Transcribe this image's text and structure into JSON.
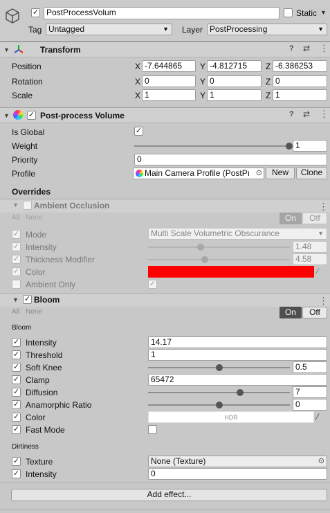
{
  "header": {
    "object_name": "PostProcessVolum",
    "static_label": "Static",
    "tag_label": "Tag",
    "tag_value": "Untagged",
    "layer_label": "Layer",
    "layer_value": "PostProcessing"
  },
  "transform": {
    "title": "Transform",
    "position_label": "Position",
    "rotation_label": "Rotation",
    "scale_label": "Scale",
    "axis_x": "X",
    "axis_y": "Y",
    "axis_z": "Z",
    "position": {
      "x": "-7.644865",
      "y": "-4.812715",
      "z": "-6.386253"
    },
    "rotation": {
      "x": "0",
      "y": "0",
      "z": "0"
    },
    "scale": {
      "x": "1",
      "y": "1",
      "z": "1"
    }
  },
  "volume": {
    "title": "Post-process Volume",
    "is_global_label": "Is Global",
    "weight_label": "Weight",
    "weight_value": "1",
    "weight_fraction": 1.0,
    "priority_label": "Priority",
    "priority_value": "0",
    "profile_label": "Profile",
    "profile_value": "Main Camera Profile (PostPı",
    "new_label": "New",
    "clone_label": "Clone",
    "overrides_label": "Overrides"
  },
  "ambient_occlusion": {
    "title": "Ambient Occlusion",
    "all_label": "All",
    "none_label": "None",
    "on_label": "On",
    "off_label": "Off",
    "mode_label": "Mode",
    "mode_value": "Multi Scale Volumetric Obscurance",
    "intensity_label": "Intensity",
    "intensity_value": "1.48",
    "intensity_fraction": 0.37,
    "thickness_label": "Thickness Modifier",
    "thickness_value": "4.58",
    "thickness_fraction": 0.4,
    "color_label": "Color",
    "color_value": "#ff0000",
    "ambient_only_label": "Ambient Only"
  },
  "bloom": {
    "title": "Bloom",
    "all_label": "All",
    "none_label": "None",
    "on_label": "On",
    "off_label": "Off",
    "section_bloom": "Bloom",
    "intensity_label": "Intensity",
    "intensity_value": "14.17",
    "threshold_label": "Threshold",
    "threshold_value": "1",
    "soft_knee_label": "Soft Knee",
    "soft_knee_value": "0.5",
    "soft_knee_fraction": 0.5,
    "clamp_label": "Clamp",
    "clamp_value": "65472",
    "diffusion_label": "Diffusion",
    "diffusion_value": "7",
    "diffusion_fraction": 0.65,
    "anamorphic_label": "Anamorphic Ratio",
    "anamorphic_value": "0",
    "anamorphic_fraction": 0.5,
    "color_label": "Color",
    "color_hdr": "HDR",
    "fast_mode_label": "Fast Mode",
    "section_dirtiness": "Dirtiness",
    "texture_label": "Texture",
    "texture_value": "None (Texture)",
    "dirt_intensity_label": "Intensity",
    "dirt_intensity_value": "0"
  },
  "footer": {
    "add_effect_label": "Add effect..."
  },
  "icons": {
    "game_object": "cube-icon",
    "transform": "axis-icon",
    "volume": "color-wheel-icon"
  }
}
